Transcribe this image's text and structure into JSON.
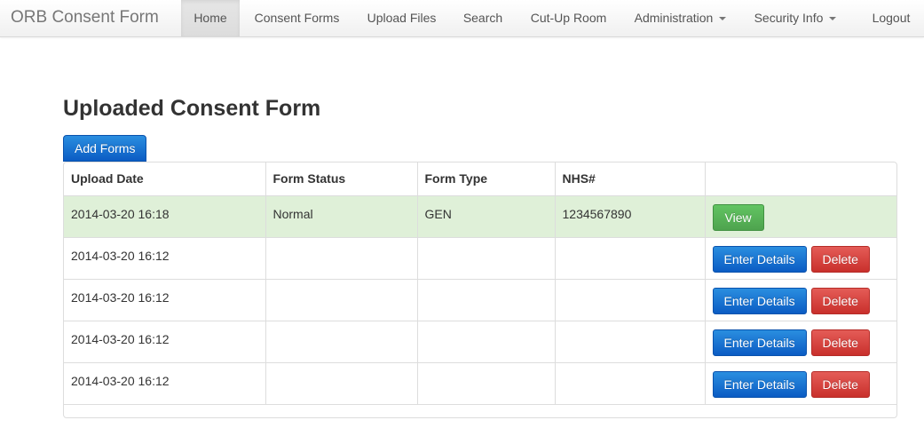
{
  "nav": {
    "brand": "ORB Consent Form",
    "items": [
      {
        "label": "Home",
        "active": true,
        "dropdown": false
      },
      {
        "label": "Consent Forms",
        "active": false,
        "dropdown": false
      },
      {
        "label": "Upload Files",
        "active": false,
        "dropdown": false
      },
      {
        "label": "Search",
        "active": false,
        "dropdown": false
      },
      {
        "label": "Cut-Up Room",
        "active": false,
        "dropdown": false
      },
      {
        "label": "Administration",
        "active": false,
        "dropdown": true
      },
      {
        "label": "Security Info",
        "active": false,
        "dropdown": true
      },
      {
        "label": "Logout",
        "active": false,
        "dropdown": false
      }
    ]
  },
  "main": {
    "title": "Uploaded Consent Form",
    "add_button": "Add Forms"
  },
  "table": {
    "headers": [
      "Upload Date",
      "Form Status",
      "Form Type",
      "NHS#",
      ""
    ],
    "rows": [
      {
        "upload_date": "2014-03-20 16:18",
        "form_status": "Normal",
        "form_type": "GEN",
        "nhs": "1234567890",
        "actions": [
          "View"
        ],
        "highlight": true
      },
      {
        "upload_date": "2014-03-20 16:12",
        "form_status": "",
        "form_type": "",
        "nhs": "",
        "actions": [
          "Enter Details",
          "Delete"
        ],
        "highlight": false
      },
      {
        "upload_date": "2014-03-20 16:12",
        "form_status": "",
        "form_type": "",
        "nhs": "",
        "actions": [
          "Enter Details",
          "Delete"
        ],
        "highlight": false
      },
      {
        "upload_date": "2014-03-20 16:12",
        "form_status": "",
        "form_type": "",
        "nhs": "",
        "actions": [
          "Enter Details",
          "Delete"
        ],
        "highlight": false
      },
      {
        "upload_date": "2014-03-20 16:12",
        "form_status": "",
        "form_type": "",
        "nhs": "",
        "actions": [
          "Enter Details",
          "Delete"
        ],
        "highlight": false
      }
    ]
  },
  "colors": {
    "primary": "#0b5cc4",
    "success": "#5bb75b",
    "danger": "#da4f49",
    "highlight_row": "#dff0d8"
  }
}
